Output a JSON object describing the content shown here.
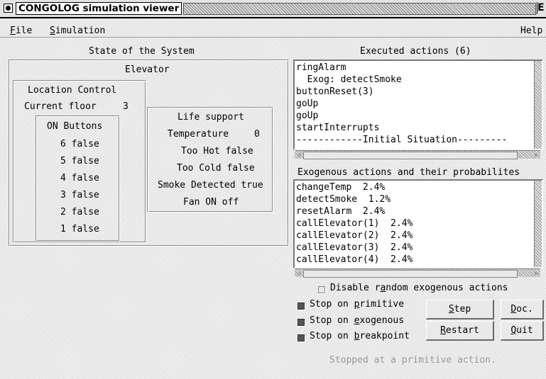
{
  "window": {
    "title": "CONGOLOG simulation viewer",
    "corner_glyph": "E"
  },
  "menu": {
    "file": {
      "first": "F",
      "rest": "ile"
    },
    "simulation": {
      "first": "S",
      "rest": "imulation"
    },
    "help": "Help"
  },
  "state": {
    "heading": "State of the System",
    "elevator": {
      "title": "Elevator",
      "location_control": {
        "title": "Location Control",
        "current_floor_label": "Current floor",
        "current_floor_value": "3",
        "on_buttons": {
          "title": "ON Buttons",
          "items": [
            "6 false",
            "5 false",
            "4 false",
            "3 false",
            "2 false",
            "1 false"
          ]
        }
      },
      "life_support": {
        "title": "Life support",
        "temperature_label": "Temperature",
        "temperature_value": "0",
        "too_hot": "Too Hot false",
        "too_cold": "Too Cold false",
        "smoke_detected": "Smoke Detected  true",
        "fan_on": "Fan ON   off"
      }
    }
  },
  "executed": {
    "heading": "Executed actions (6)",
    "items": [
      "ringAlarm",
      "  Exog: detectSmoke",
      "buttonReset(3)",
      "goUp",
      "goUp",
      "startInterrupts",
      "------------Initial Situation---------"
    ]
  },
  "exogenous": {
    "heading": "Exogenous actions and their probabilites",
    "items": [
      "changeTemp  2.4%",
      "detectSmoke  1.2%",
      "resetAlarm  2.4%",
      "callElevator(1)  2.4%",
      "callElevator(2)  2.4%",
      "callElevator(3)  2.4%",
      "callElevator(4)  2.4%"
    ]
  },
  "controls": {
    "disable_random": {
      "label_before": "Disable r",
      "mnemonic": "a",
      "label_after": "ndom exogenous actions",
      "checked": false
    },
    "stop_primitive": {
      "label_before": "Stop on ",
      "mnemonic": "p",
      "label_after": "rimitive",
      "checked": true
    },
    "stop_exogenous": {
      "label_before": "Stop on ",
      "mnemonic": "e",
      "label_after": "xogenous",
      "checked": true
    },
    "stop_breakpoint": {
      "label_before": "Stop on ",
      "mnemonic": "b",
      "label_after": "reakpoint",
      "checked": true
    },
    "step": {
      "first": "S",
      "rest": "tep"
    },
    "doc": {
      "first": "D",
      "rest": "oc."
    },
    "restart": {
      "first": "R",
      "rest": "estart"
    },
    "quit": {
      "first": "Q",
      "rest": "uit"
    }
  },
  "status_text": "Stopped at a primitive action."
}
